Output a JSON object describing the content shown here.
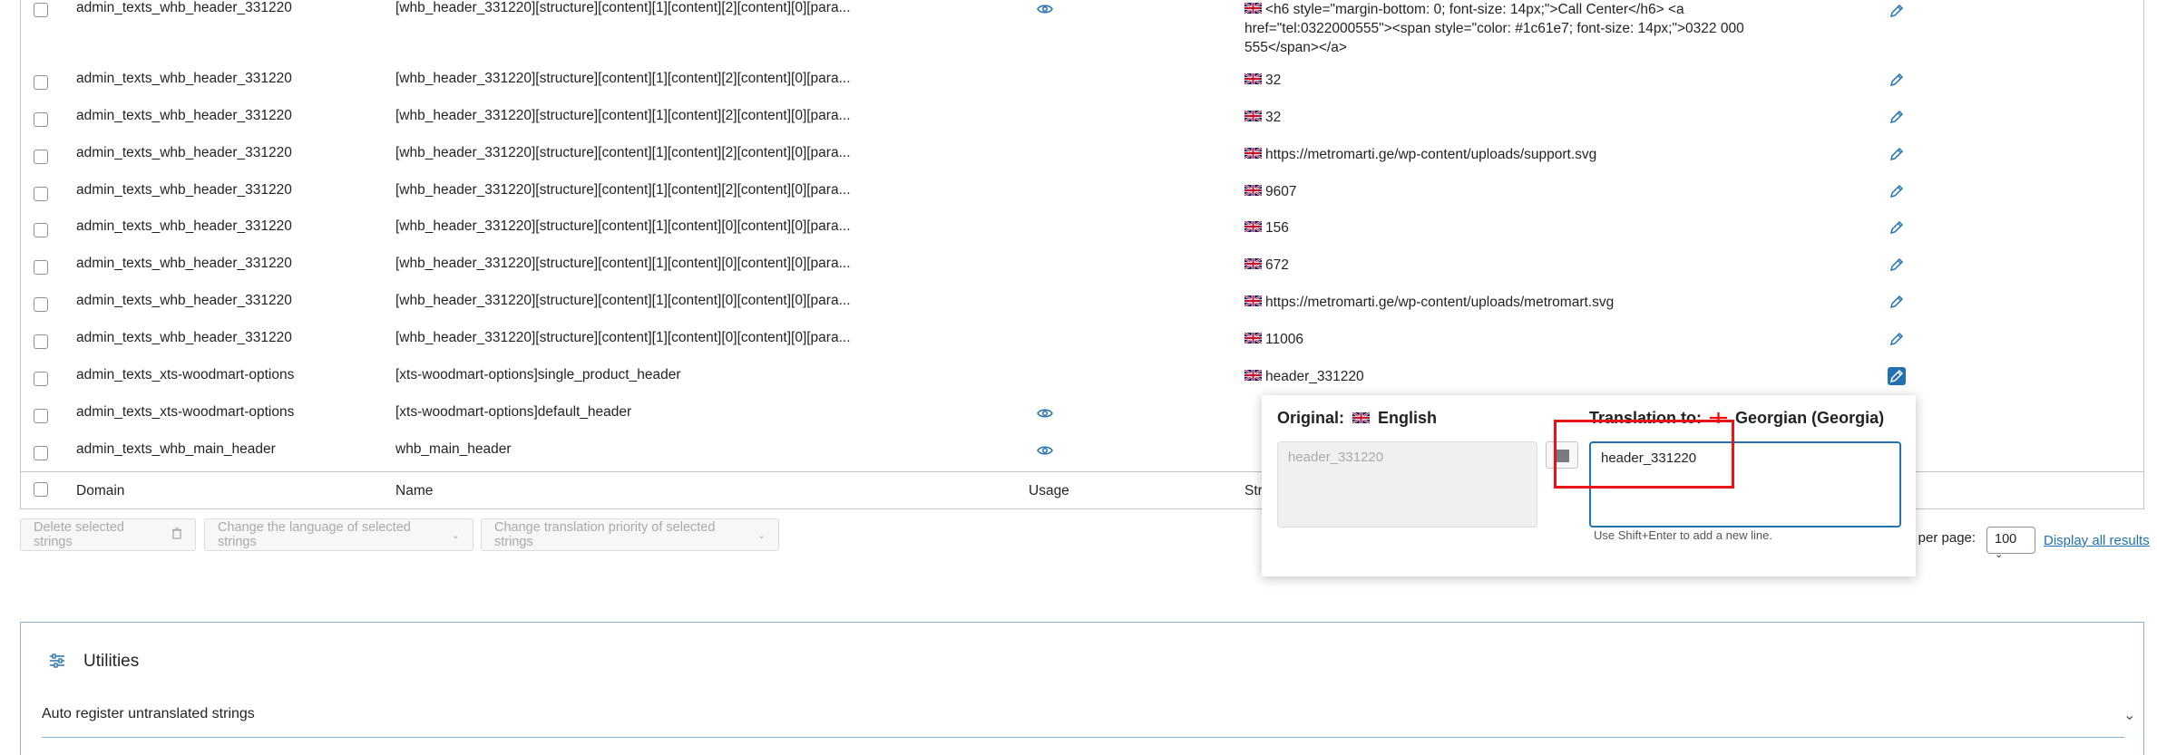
{
  "rows": [
    {
      "domain": "admin_texts_whb_header_331220",
      "name": "[whb_header_331220][structure][content][1][content][2][content][0][para...",
      "usage": true,
      "value": "<h6 style=\"margin-bottom: 0; font-size: 14px;\">Call Center</h6> <a href=\"tel:0322000555\"><span style=\"color: #1c61e7; font-size: 14px;\">0322 000 555</span></a>"
    },
    {
      "domain": "admin_texts_whb_header_331220",
      "name": "[whb_header_331220][structure][content][1][content][2][content][0][para...",
      "usage": false,
      "value": "32"
    },
    {
      "domain": "admin_texts_whb_header_331220",
      "name": "[whb_header_331220][structure][content][1][content][2][content][0][para...",
      "usage": false,
      "value": "32"
    },
    {
      "domain": "admin_texts_whb_header_331220",
      "name": "[whb_header_331220][structure][content][1][content][2][content][0][para...",
      "usage": false,
      "value": "https://metromarti.ge/wp-content/uploads/support.svg"
    },
    {
      "domain": "admin_texts_whb_header_331220",
      "name": "[whb_header_331220][structure][content][1][content][2][content][0][para...",
      "usage": false,
      "value": "9607"
    },
    {
      "domain": "admin_texts_whb_header_331220",
      "name": "[whb_header_331220][structure][content][1][content][0][content][0][para...",
      "usage": false,
      "value": "156"
    },
    {
      "domain": "admin_texts_whb_header_331220",
      "name": "[whb_header_331220][structure][content][1][content][0][content][0][para...",
      "usage": false,
      "value": "672"
    },
    {
      "domain": "admin_texts_whb_header_331220",
      "name": "[whb_header_331220][structure][content][1][content][0][content][0][para...",
      "usage": false,
      "value": "https://metromarti.ge/wp-content/uploads/metromart.svg"
    },
    {
      "domain": "admin_texts_whb_header_331220",
      "name": "[whb_header_331220][structure][content][1][content][0][content][0][para...",
      "usage": false,
      "value": "11006"
    },
    {
      "domain": "admin_texts_xts-woodmart-options",
      "name": "[xts-woodmart-options]single_product_header",
      "usage": false,
      "value": "header_331220"
    },
    {
      "domain": "admin_texts_xts-woodmart-options",
      "name": "[xts-woodmart-options]default_header",
      "usage": true,
      "value": ""
    },
    {
      "domain": "admin_texts_whb_main_header",
      "name": "whb_main_header",
      "usage": true,
      "value": ""
    }
  ],
  "footer": {
    "domain": "Domain",
    "name": "Name",
    "usage": "Usage",
    "strings": "Stri"
  },
  "bulk": {
    "delete": "Delete selected strings",
    "language": "Change the language of selected strings",
    "priority": "Change translation priority of selected strings"
  },
  "pagination": {
    "per_page_label": "s per page:",
    "per_page_value": "100",
    "display_all": "Display all results"
  },
  "popup": {
    "original_label": "Original:",
    "original_lang": "English",
    "translation_label": "Translation to:",
    "translation_lang": "Georgian (Georgia)",
    "original_value": "header_331220",
    "translation_value": "header_331220",
    "hint": "Use Shift+Enter to add a new line."
  },
  "utilities": {
    "title": "Utilities",
    "auto_register": "Auto register untranslated strings"
  },
  "colors": {
    "accent": "#2271b1",
    "highlight": "#e8141a"
  }
}
